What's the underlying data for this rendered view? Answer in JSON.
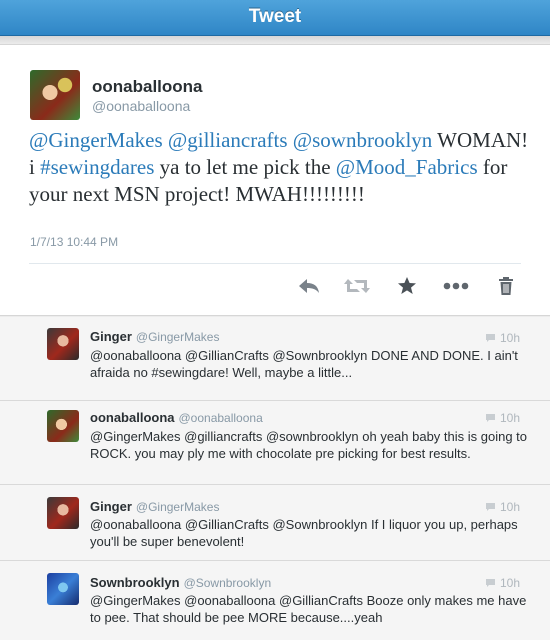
{
  "title": "Tweet",
  "tweet": {
    "author_name": "oonaballoona",
    "author_handle": "@oonaballoona",
    "text_parts": [
      {
        "t": "@GingerMakes",
        "link": true
      },
      {
        "t": " ",
        "link": false
      },
      {
        "t": "@gilliancrafts",
        "link": true
      },
      {
        "t": " ",
        "link": false
      },
      {
        "t": "@sownbrooklyn",
        "link": true
      },
      {
        "t": " WOMAN! i ",
        "link": false
      },
      {
        "t": "#sewingdares",
        "link": true
      },
      {
        "t": " ya to let me pick the ",
        "link": false
      },
      {
        "t": "@Mood_Fabrics",
        "link": true
      },
      {
        "t": " for your next MSN project! MWAH!!!!!!!!!",
        "link": false
      }
    ],
    "timestamp": "1/7/13 10:44 PM"
  },
  "actions": [
    "reply-icon",
    "retweet-icon",
    "favorite-icon",
    "more-icon",
    "delete-icon"
  ],
  "replies": [
    {
      "name": "Ginger",
      "handle": "@GingerMakes",
      "time": "10h",
      "avatar": "ginger",
      "text": "@oonaballoona @GillianCrafts @Sownbrooklyn DONE AND DONE.  I ain't afraida no #sewingdare!  Well, maybe a little..."
    },
    {
      "name": "oonaballoona",
      "handle": "@oonaballoona",
      "time": "10h",
      "avatar": "oona",
      "text": "@GingerMakes @gilliancrafts @sownbrooklyn oh yeah baby this is going to ROCK. you may ply me with chocolate pre picking for best results."
    },
    {
      "name": "Ginger",
      "handle": "@GingerMakes",
      "time": "10h",
      "avatar": "ginger",
      "text": "@oonaballoona @GillianCrafts @Sownbrooklyn If I liquor you up, perhaps you'll be super benevolent!"
    },
    {
      "name": "Sownbrooklyn",
      "handle": "@Sownbrooklyn",
      "time": "10h",
      "avatar": "sown",
      "text": "@GingerMakes @oonaballoona @GillianCrafts Booze only makes me have to pee. That should be pee MORE because....yeah"
    }
  ],
  "colors": {
    "header": "#2f86c6",
    "link": "#2b7bb9",
    "muted": "#8899a6"
  }
}
